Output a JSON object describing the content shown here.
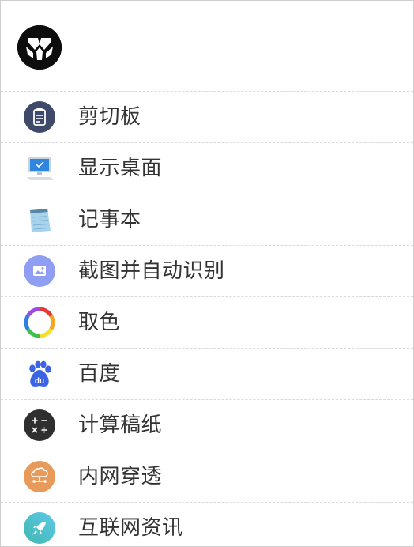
{
  "header": {
    "logo_icon": "app-logo-icon"
  },
  "menu": {
    "items": [
      {
        "label": "剪切板",
        "icon": "clipboard-icon",
        "color": "#3f4a6b"
      },
      {
        "label": "显示桌面",
        "icon": "monitor-icon",
        "color": "#4a90d9"
      },
      {
        "label": "记事本",
        "icon": "notepad-icon",
        "color": "#6aa6c8"
      },
      {
        "label": "截图并自动识别",
        "icon": "image-scan-icon",
        "color": "#8f9df2"
      },
      {
        "label": "取色",
        "icon": "color-wheel-icon",
        "color": "#e33b3b"
      },
      {
        "label": "百度",
        "icon": "baidu-paw-icon",
        "color": "#3a63e6"
      },
      {
        "label": "计算稿纸",
        "icon": "calculator-icon",
        "color": "#2f2f2f"
      },
      {
        "label": "内网穿透",
        "icon": "network-tunnel-icon",
        "color": "#e79a5a"
      },
      {
        "label": "互联网资讯",
        "icon": "rocket-icon",
        "color": "#4fc3b2"
      }
    ]
  }
}
